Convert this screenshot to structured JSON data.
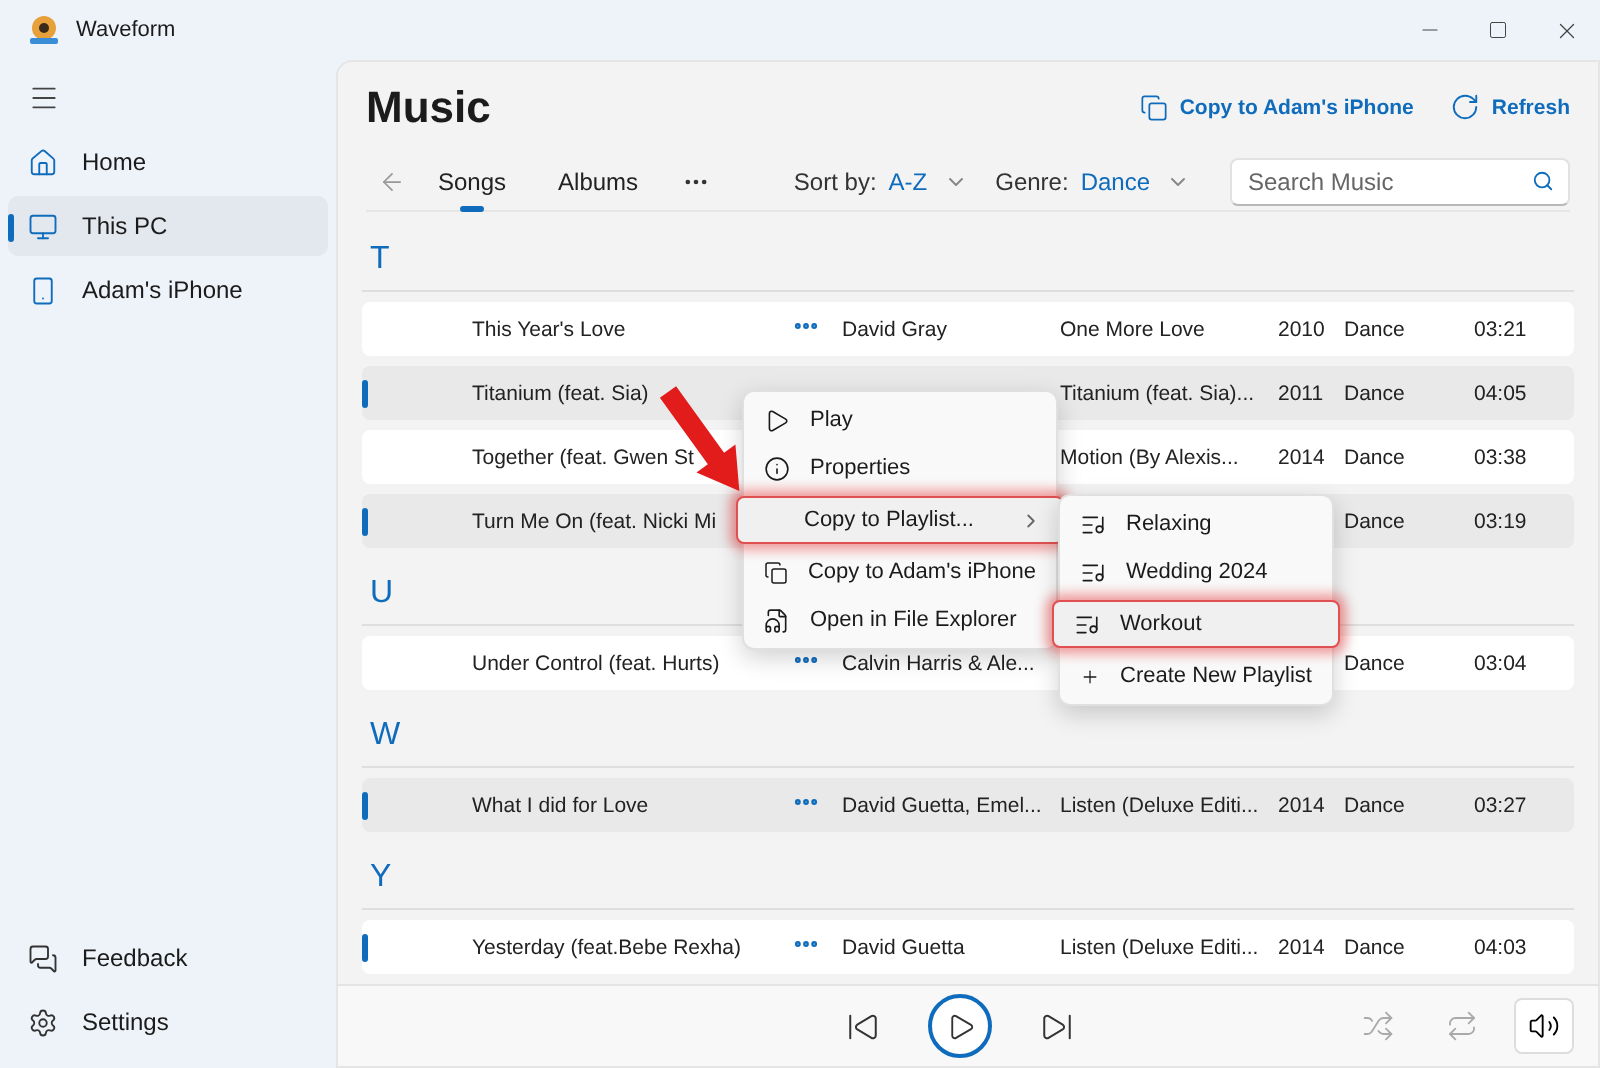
{
  "window": {
    "title": "Waveform"
  },
  "sidebar": {
    "items": [
      {
        "label": "Home",
        "selected": false
      },
      {
        "label": "This PC",
        "selected": true
      },
      {
        "label": "Adam's iPhone",
        "selected": false
      }
    ],
    "footer": [
      {
        "label": "Feedback"
      },
      {
        "label": "Settings"
      }
    ]
  },
  "header": {
    "title": "Music",
    "actions": [
      {
        "label": "Copy to Adam's iPhone"
      },
      {
        "label": "Refresh"
      }
    ]
  },
  "toolbar": {
    "tabs": [
      {
        "label": "Songs",
        "selected": true
      },
      {
        "label": "Albums",
        "selected": false
      }
    ],
    "sort": {
      "label": "Sort by:",
      "value": "A-Z"
    },
    "genre": {
      "label": "Genre:",
      "value": "Dance"
    },
    "search": {
      "placeholder": "Search Music"
    }
  },
  "groups": [
    {
      "letter": "T",
      "rows": [
        {
          "title": "This Year's Love",
          "more": true,
          "artist": "David Gray",
          "album": "One More Love",
          "year": "2010",
          "genre": "Dance",
          "duration": "03:21",
          "selected": false,
          "shaded": false
        },
        {
          "title": "Titanium (feat. Sia)",
          "more": false,
          "album": "Titanium (feat. Sia)...",
          "year": "2011",
          "genre": "Dance",
          "duration": "04:05",
          "selected": true,
          "shaded": true
        },
        {
          "title": "Together (feat. Gwen St",
          "more": false,
          "album": "Motion (By Alexis...",
          "year": "2014",
          "genre": "Dance",
          "duration": "03:38",
          "selected": false,
          "shaded": false
        },
        {
          "title": "Turn Me On (feat. Nicki Mi",
          "more": false,
          "genre": "Dance",
          "duration": "03:19",
          "selected": true,
          "shaded": true
        }
      ]
    },
    {
      "letter": "U",
      "rows": [
        {
          "title": "Under Control (feat. Hurts)",
          "more": true,
          "artist": "Calvin Harris & Ale...",
          "genre": "Dance",
          "duration": "03:04",
          "selected": false,
          "shaded": false
        }
      ]
    },
    {
      "letter": "W",
      "rows": [
        {
          "title": "What I did for Love",
          "more": true,
          "artist": "David Guetta, Emel...",
          "album": "Listen (Deluxe Editi...",
          "year": "2014",
          "genre": "Dance",
          "duration": "03:27",
          "selected": true,
          "shaded": true
        }
      ]
    },
    {
      "letter": "Y",
      "rows": [
        {
          "title": "Yesterday (feat.Bebe Rexha)",
          "more": true,
          "artist": "David Guetta",
          "album": "Listen (Deluxe Editi...",
          "year": "2014",
          "genre": "Dance",
          "duration": "04:03",
          "selected": true,
          "shaded": false
        }
      ]
    }
  ],
  "context_menu": {
    "items": [
      {
        "label": "Play",
        "highlighted": false,
        "submenu": false
      },
      {
        "label": "Properties",
        "highlighted": false,
        "submenu": false
      },
      {
        "label": "Copy to Playlist...",
        "highlighted": true,
        "submenu": true
      },
      {
        "label": "Copy to Adam's iPhone",
        "highlighted": false,
        "submenu": false
      },
      {
        "label": "Open in File Explorer",
        "highlighted": false,
        "submenu": false
      }
    ]
  },
  "submenu": {
    "items": [
      {
        "label": "Relaxing",
        "kind": "playlist",
        "highlighted": false
      },
      {
        "label": "Wedding 2024",
        "kind": "playlist",
        "highlighted": false
      },
      {
        "label": "Workout",
        "kind": "playlist",
        "highlighted": true
      },
      {
        "label": "Create New Playlist",
        "kind": "create",
        "highlighted": false
      }
    ]
  }
}
